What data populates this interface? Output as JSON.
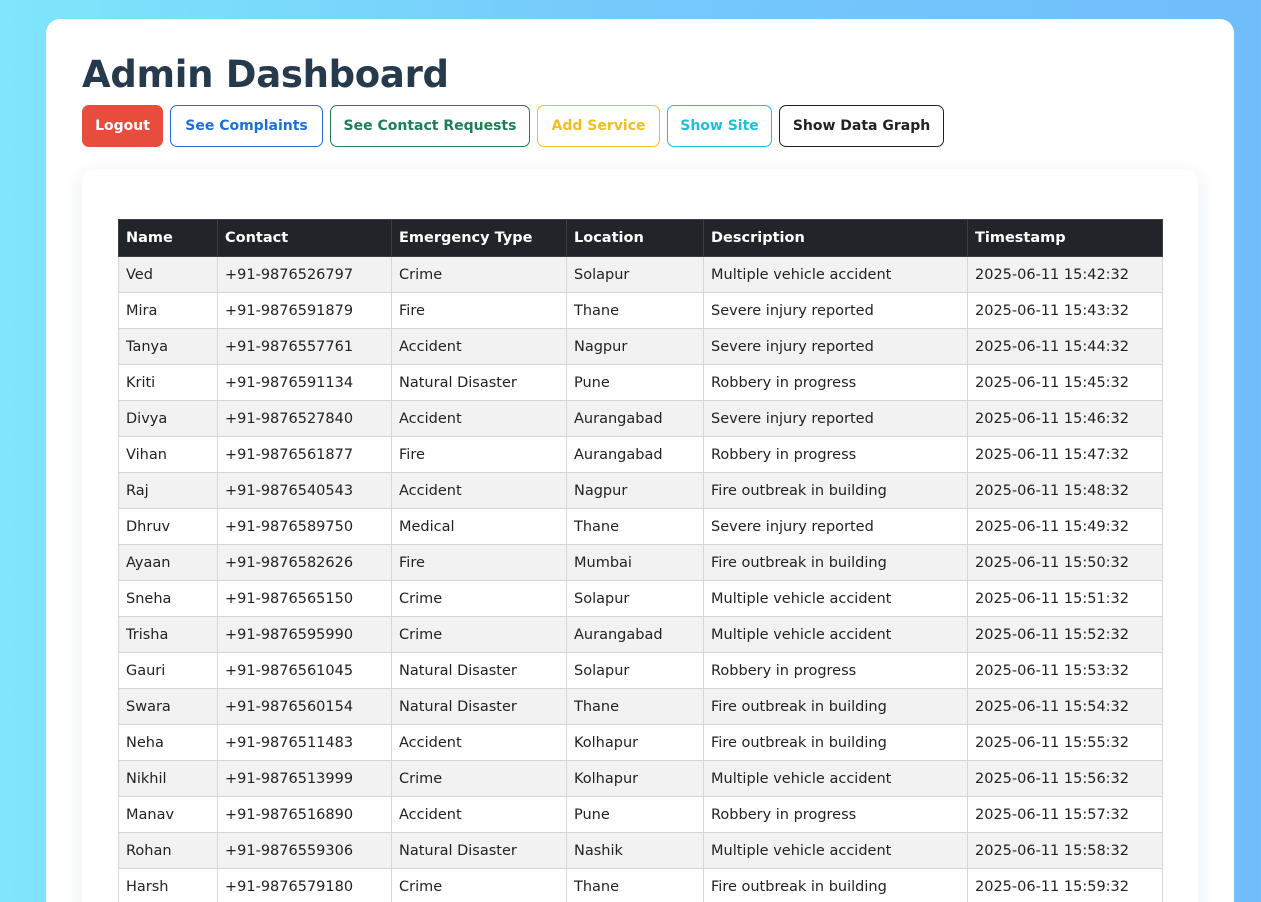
{
  "header": {
    "title": "Admin Dashboard"
  },
  "toolbar": {
    "logout_label": "Logout",
    "complaints_label": "See Complaints",
    "contact_requests_label": "See Contact Requests",
    "add_service_label": "Add Service",
    "show_site_label": "Show Site",
    "data_graph_label": "Show Data Graph"
  },
  "colors": {
    "title": "#263a4d",
    "logout": "#e74c3c",
    "complaints": "#1e6fd9",
    "contacts": "#1d7f55",
    "service": "#f2bf1f",
    "site": "#1fbfd9",
    "graph": "#222222",
    "table_header": "#212529"
  },
  "table": {
    "columns": [
      "Name",
      "Contact",
      "Emergency Type",
      "Location",
      "Description",
      "Timestamp"
    ],
    "rows": [
      [
        "Ved",
        "+91-9876526797",
        "Crime",
        "Solapur",
        "Multiple vehicle accident",
        "2025-06-11 15:42:32"
      ],
      [
        "Mira",
        "+91-9876591879",
        "Fire",
        "Thane",
        "Severe injury reported",
        "2025-06-11 15:43:32"
      ],
      [
        "Tanya",
        "+91-9876557761",
        "Accident",
        "Nagpur",
        "Severe injury reported",
        "2025-06-11 15:44:32"
      ],
      [
        "Kriti",
        "+91-9876591134",
        "Natural Disaster",
        "Pune",
        "Robbery in progress",
        "2025-06-11 15:45:32"
      ],
      [
        "Divya",
        "+91-9876527840",
        "Accident",
        "Aurangabad",
        "Severe injury reported",
        "2025-06-11 15:46:32"
      ],
      [
        "Vihan",
        "+91-9876561877",
        "Fire",
        "Aurangabad",
        "Robbery in progress",
        "2025-06-11 15:47:32"
      ],
      [
        "Raj",
        "+91-9876540543",
        "Accident",
        "Nagpur",
        "Fire outbreak in building",
        "2025-06-11 15:48:32"
      ],
      [
        "Dhruv",
        "+91-9876589750",
        "Medical",
        "Thane",
        "Severe injury reported",
        "2025-06-11 15:49:32"
      ],
      [
        "Ayaan",
        "+91-9876582626",
        "Fire",
        "Mumbai",
        "Fire outbreak in building",
        "2025-06-11 15:50:32"
      ],
      [
        "Sneha",
        "+91-9876565150",
        "Crime",
        "Solapur",
        "Multiple vehicle accident",
        "2025-06-11 15:51:32"
      ],
      [
        "Trisha",
        "+91-9876595990",
        "Crime",
        "Aurangabad",
        "Multiple vehicle accident",
        "2025-06-11 15:52:32"
      ],
      [
        "Gauri",
        "+91-9876561045",
        "Natural Disaster",
        "Solapur",
        "Robbery in progress",
        "2025-06-11 15:53:32"
      ],
      [
        "Swara",
        "+91-9876560154",
        "Natural Disaster",
        "Thane",
        "Fire outbreak in building",
        "2025-06-11 15:54:32"
      ],
      [
        "Neha",
        "+91-9876511483",
        "Accident",
        "Kolhapur",
        "Fire outbreak in building",
        "2025-06-11 15:55:32"
      ],
      [
        "Nikhil",
        "+91-9876513999",
        "Crime",
        "Kolhapur",
        "Multiple vehicle accident",
        "2025-06-11 15:56:32"
      ],
      [
        "Manav",
        "+91-9876516890",
        "Accident",
        "Pune",
        "Robbery in progress",
        "2025-06-11 15:57:32"
      ],
      [
        "Rohan",
        "+91-9876559306",
        "Natural Disaster",
        "Nashik",
        "Multiple vehicle accident",
        "2025-06-11 15:58:32"
      ],
      [
        "Harsh",
        "+91-9876579180",
        "Crime",
        "Thane",
        "Fire outbreak in building",
        "2025-06-11 15:59:32"
      ]
    ]
  }
}
